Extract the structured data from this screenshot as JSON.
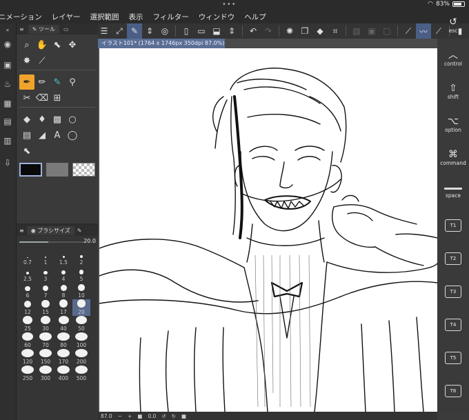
{
  "status": {
    "dots": "•••",
    "battery": "83%"
  },
  "menu": [
    "ニメーション",
    "レイヤー",
    "選択範囲",
    "表示",
    "フィルター",
    "ウィンドウ",
    "ヘルプ"
  ],
  "tool_panel": {
    "tab_label": "ツール"
  },
  "brush_panel": {
    "tab_label": "ブラシサイズ",
    "value": "20.0"
  },
  "brush_sizes": [
    "0.7",
    "1",
    "1.5",
    "2",
    "2.5",
    "3",
    "4",
    "5",
    "6",
    "7",
    "8",
    "10",
    "12",
    "15",
    "17",
    "20",
    "25",
    "30",
    "40",
    "50",
    "60",
    "70",
    "80",
    "100",
    "120",
    "150",
    "170",
    "200",
    "250",
    "300",
    "400",
    "500"
  ],
  "brush_selected": "20",
  "document": {
    "tab_title": "イラスト101* (1764 x 1746px 350dpi 87.0%)"
  },
  "bottom": {
    "zoom": "87.0",
    "rotation": "0.0"
  },
  "edge_keys": {
    "esc": "esc",
    "control": "control",
    "shift": "shift",
    "option": "option",
    "command": "command",
    "space": "space",
    "t1": "T1",
    "t2": "T2",
    "t3": "T3",
    "t4": "T4",
    "t5": "T5",
    "t6": "T6"
  },
  "colors": {
    "accent_selected_tool": "#f0a32b",
    "doc_tab": "#5b6f95",
    "selected_brush": "#5a6a8c"
  }
}
